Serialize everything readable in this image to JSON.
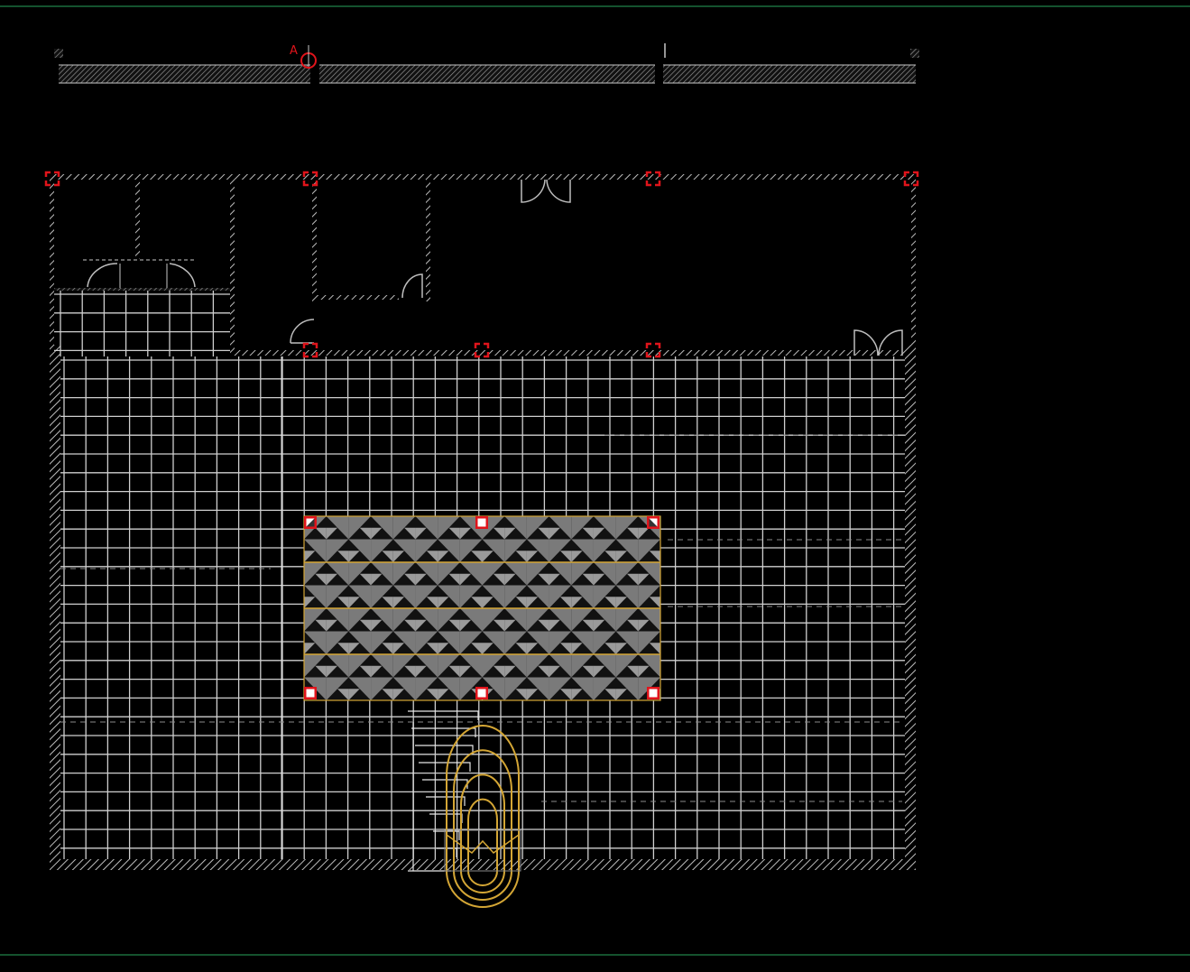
{
  "viewport": {
    "background": "#000000"
  },
  "colors": {
    "frame": "#27a55b",
    "wall": "#c7c7c7",
    "grid": "#cfcfcf",
    "grip": "#e0141b",
    "tile_gray": "#7a7a7a",
    "tile_black": "#111111",
    "gold": "#d4a635",
    "door": "#bdbdbd"
  },
  "section_marker": {
    "letter": "A",
    "icon": "section-marker-icon"
  },
  "tile_pattern": {
    "name": "decorative-tile-rug",
    "rows": 4,
    "cols": 16,
    "selected": true
  },
  "grips": {
    "count": 14,
    "icon": "grip-square-icon"
  },
  "fountain": {
    "name": "arched-water-feature",
    "rings": 4
  }
}
